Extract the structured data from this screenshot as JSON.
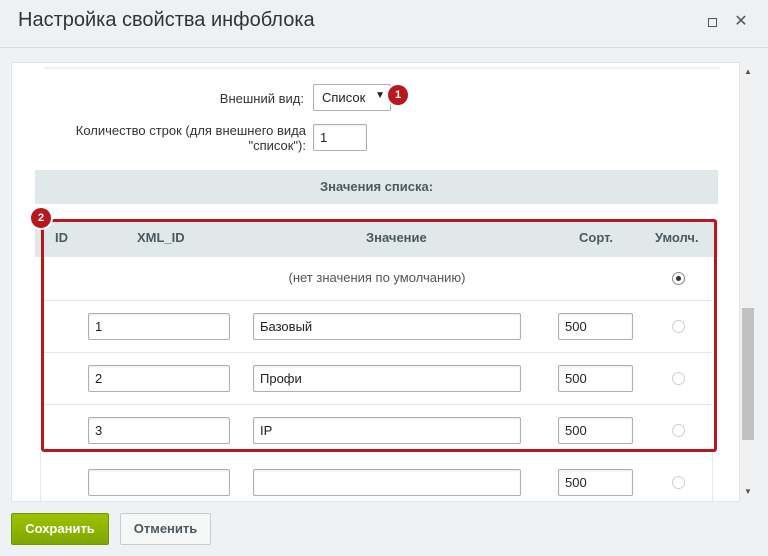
{
  "window": {
    "title": "Настройка свойства инфоблока"
  },
  "form": {
    "appearance_label": "Внешний вид:",
    "appearance_value": "Список",
    "rows_label_line1": "Количество строк (для внешнего вида",
    "rows_label_line2": "\"список\"):",
    "rows_value": "1"
  },
  "badges": {
    "b1": "1",
    "b2": "2"
  },
  "list": {
    "section_title": "Значения списка:",
    "columns": {
      "id": "ID",
      "xml_id": "XML_ID",
      "value": "Значение",
      "sort": "Сорт.",
      "default": "Умолч."
    },
    "no_default_text": "(нет значения по умолчанию)",
    "rows": [
      {
        "xml_id": "1",
        "value": "Базовый",
        "sort": "500",
        "default": false
      },
      {
        "xml_id": "2",
        "value": "Профи",
        "sort": "500",
        "default": false
      },
      {
        "xml_id": "3",
        "value": "IP",
        "sort": "500",
        "default": false
      },
      {
        "xml_id": "",
        "value": "",
        "sort": "500",
        "default": false
      }
    ],
    "no_default_selected": true
  },
  "footer": {
    "save_label": "Сохранить",
    "cancel_label": "Отменить"
  },
  "colors": {
    "accent_red": "#b7181f",
    "save_green": "#86ad00",
    "header_bg": "#e0e8ea"
  }
}
